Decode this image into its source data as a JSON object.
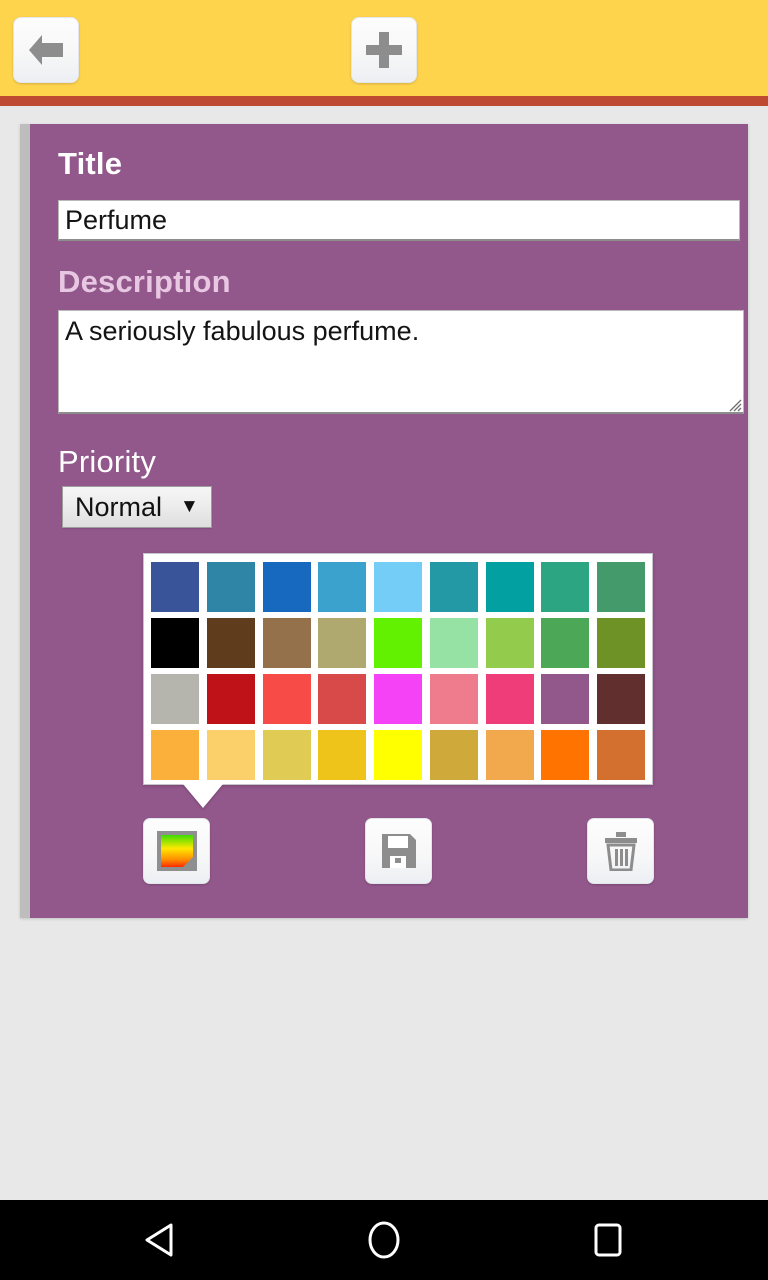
{
  "toolbar": {
    "back_icon": "arrow-left-icon",
    "add_icon": "plus-icon",
    "background_color": "#ffd44d",
    "divider_color": "#bf4a32"
  },
  "card": {
    "background_color": "#92588c",
    "title": {
      "label": "Title",
      "value": "Perfume",
      "placeholder": "Title"
    },
    "description": {
      "label": "Description",
      "value": "A seriously fabulous perfume.",
      "placeholder": "Description"
    },
    "priority": {
      "label": "Priority",
      "selected": "Normal",
      "caret": "▼",
      "options": [
        "Normal"
      ]
    }
  },
  "palette": {
    "rows": [
      [
        "#3a5499",
        "#2e85a5",
        "#1769c0",
        "#3ba2ce",
        "#74cdf7",
        "#2399a5",
        "#02a0a0",
        "#2ca582",
        "#459a6b"
      ],
      [
        "#000000",
        "#5e3c1c",
        "#94714a",
        "#b0a96f",
        "#62f201",
        "#96e2a4",
        "#93cb4d",
        "#4ca756",
        "#6e9226"
      ],
      [
        "#b6b5ad",
        "#bf1118",
        "#f64b46",
        "#d84a4a",
        "#f642f7",
        "#ef7c8d",
        "#ee3d78",
        "#92588c",
        "#61302e"
      ],
      [
        "#fcb03c",
        "#fbd06a",
        "#e0cb55",
        "#eec41b",
        "#ffff00",
        "#cfa93a",
        "#f2a94e",
        "#ff7300",
        "#d4702f"
      ]
    ]
  },
  "actions": {
    "color_picker": {
      "name": "color-picker-button",
      "icon": "color-swatch-icon"
    },
    "save": {
      "name": "save-button",
      "icon": "floppy-disk-icon"
    },
    "delete": {
      "name": "delete-button",
      "icon": "trash-icon"
    }
  },
  "navbar": {
    "back": "triangle-back-icon",
    "home": "circle-home-icon",
    "recents": "square-recents-icon",
    "background_color": "#000000"
  }
}
